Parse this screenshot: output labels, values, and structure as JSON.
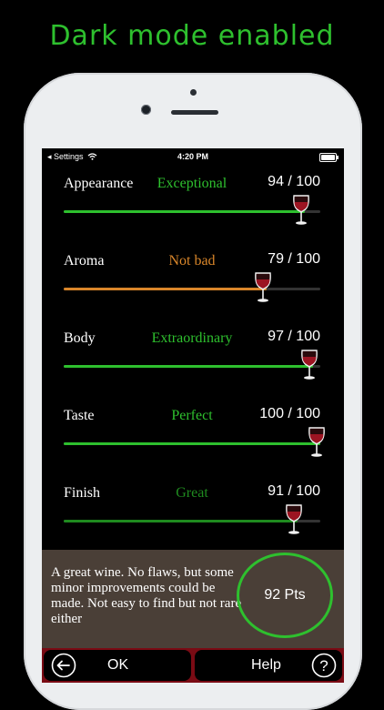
{
  "banner": "Dark mode enabled",
  "status": {
    "carrier": "◂ Settings",
    "time": "4:20 PM"
  },
  "colors": {
    "green": "#2ec02e",
    "orange": "#d9862a",
    "wine": "#7a0b14",
    "summary_bg": "#4a3f37"
  },
  "criteria": [
    {
      "name": "Appearance",
      "rating": "Exceptional",
      "score": "94 / 100",
      "value": 94,
      "color": "#2ec02e"
    },
    {
      "name": "Aroma",
      "rating": "Not bad",
      "score": "79 / 100",
      "value": 79,
      "color": "#d9862a"
    },
    {
      "name": "Body",
      "rating": "Extraordinary",
      "score": "97 / 100",
      "value": 97,
      "color": "#2ec02e"
    },
    {
      "name": "Taste",
      "rating": "Perfect",
      "score": "100 / 100",
      "value": 100,
      "color": "#2ec02e"
    },
    {
      "name": "Finish",
      "rating": "Great",
      "score": "91 / 100",
      "value": 91,
      "color": "#1f8a1f"
    }
  ],
  "summary": {
    "text": "A great wine. No flaws, but some minor improvements could be made. Not easy to find but not rare either",
    "points": "92 Pts"
  },
  "buttons": {
    "ok": "OK",
    "help": "Help"
  }
}
